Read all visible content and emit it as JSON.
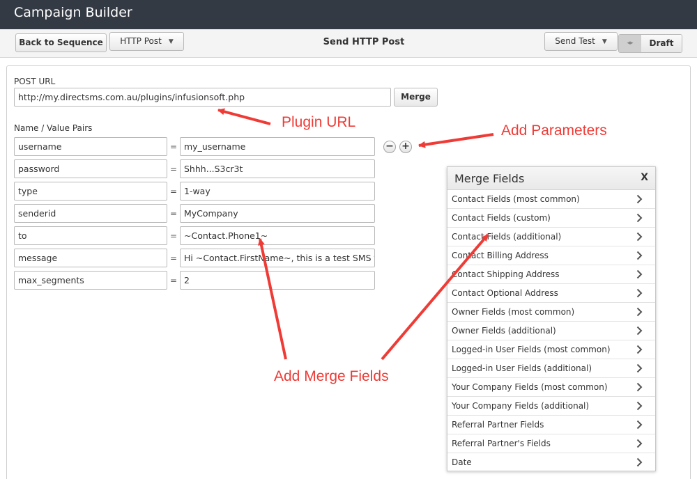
{
  "app": {
    "title": "Campaign Builder"
  },
  "toolbar": {
    "back_label": "Back to Sequence",
    "method_label": "HTTP Post",
    "page_title": "Send HTTP Post",
    "send_test_label": "Send Test",
    "toggle_off_symbol": "◂▸",
    "draft_label": "Draft"
  },
  "form": {
    "post_url_label": "POST URL",
    "post_url_value": "http://my.directsms.com.au/plugins/infusionsoft.php",
    "merge_label": "Merge",
    "pairs_label": "Name / Value Pairs",
    "equals": "=",
    "remove_symbol": "−",
    "add_symbol": "+",
    "pairs": [
      {
        "name": "username",
        "value": "my_username"
      },
      {
        "name": "password",
        "value": "Shhh...S3cr3t"
      },
      {
        "name": "type",
        "value": "1-way"
      },
      {
        "name": "senderid",
        "value": "MyCompany"
      },
      {
        "name": "to",
        "value": "~Contact.Phone1~"
      },
      {
        "name": "message",
        "value": "Hi ~Contact.FirstName~, this is a test SMS from"
      },
      {
        "name": "max_segments",
        "value": "2"
      }
    ]
  },
  "annotations": {
    "plugin_url": "Plugin URL",
    "add_parameters": "Add Parameters",
    "add_merge_fields": "Add Merge Fields",
    "color": "#ef3b36"
  },
  "merge_fields": {
    "title": "Merge Fields",
    "close_label": "X",
    "items": [
      "Contact Fields (most common)",
      "Contact Fields (custom)",
      "Contact Fields (additional)",
      "Contact Billing Address",
      "Contact Shipping Address",
      "Contact Optional Address",
      "Owner Fields (most common)",
      "Owner Fields (additional)",
      "Logged-in User Fields (most common)",
      "Logged-in User Fields (additional)",
      "Your Company Fields (most common)",
      "Your Company Fields (additional)",
      "Referral Partner Fields",
      "Referral Partner's Fields",
      "Date"
    ]
  }
}
